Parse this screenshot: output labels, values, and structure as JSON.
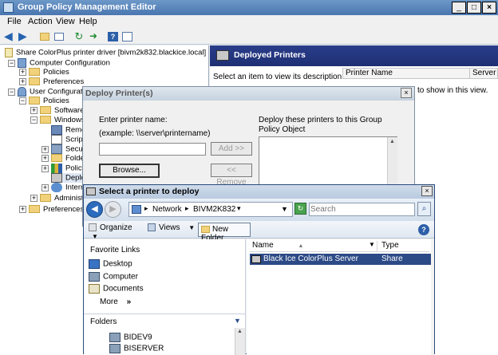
{
  "main_window": {
    "title": "Group Policy Management Editor",
    "menu": [
      "File",
      "Action",
      "View",
      "Help"
    ],
    "tree_root": "Share ColorPlus printer driver [bivm2k832.blackice.local] Policy",
    "tree": [
      {
        "label": "Computer Configuration"
      },
      {
        "label": "Policies"
      },
      {
        "label": "Preferences"
      },
      {
        "label": "User Configuration"
      },
      {
        "label": "Policies"
      },
      {
        "label": "Software"
      },
      {
        "label": "Windows"
      },
      {
        "label": "Remo"
      },
      {
        "label": "Script"
      },
      {
        "label": "Secur"
      },
      {
        "label": "Folder"
      },
      {
        "label": "Policy"
      },
      {
        "label": "Deplo"
      },
      {
        "label": "Intern"
      },
      {
        "label": "Administra"
      },
      {
        "label": "Preferences"
      }
    ],
    "right_header": "Deployed Printers",
    "right_desc": "Select an item to view its description.",
    "col_printer_name": "Printer Name",
    "col_server": "Server N",
    "show_text": "to show in this view."
  },
  "deploy_dialog": {
    "title": "Deploy Printer(s)",
    "enter_label": "Enter printer name:",
    "example_label": "(example: \\\\server\\printername)",
    "add_button": "Add >>",
    "browse_button": "Browse...",
    "remove_button": "<< Remove",
    "deploy_label": "Deploy these printers to this Group Policy Object"
  },
  "select_dialog": {
    "title": "Select a printer to deploy",
    "breadcrumb": [
      "Network",
      "BIVM2K832"
    ],
    "search_placeholder": "Search",
    "organize": "Organize",
    "views": "Views",
    "new_folder": "New Folder",
    "favorite_links_title": "Favorite Links",
    "favorite_links": [
      "Desktop",
      "Computer",
      "Documents"
    ],
    "more": "More",
    "folders_label": "Folders",
    "folders": [
      "BIDEV9",
      "BISERVER"
    ],
    "col_name": "Name",
    "col_type": "Type",
    "rows": [
      {
        "name": "Black Ice ColorPlus Server",
        "type": "Share"
      }
    ]
  }
}
